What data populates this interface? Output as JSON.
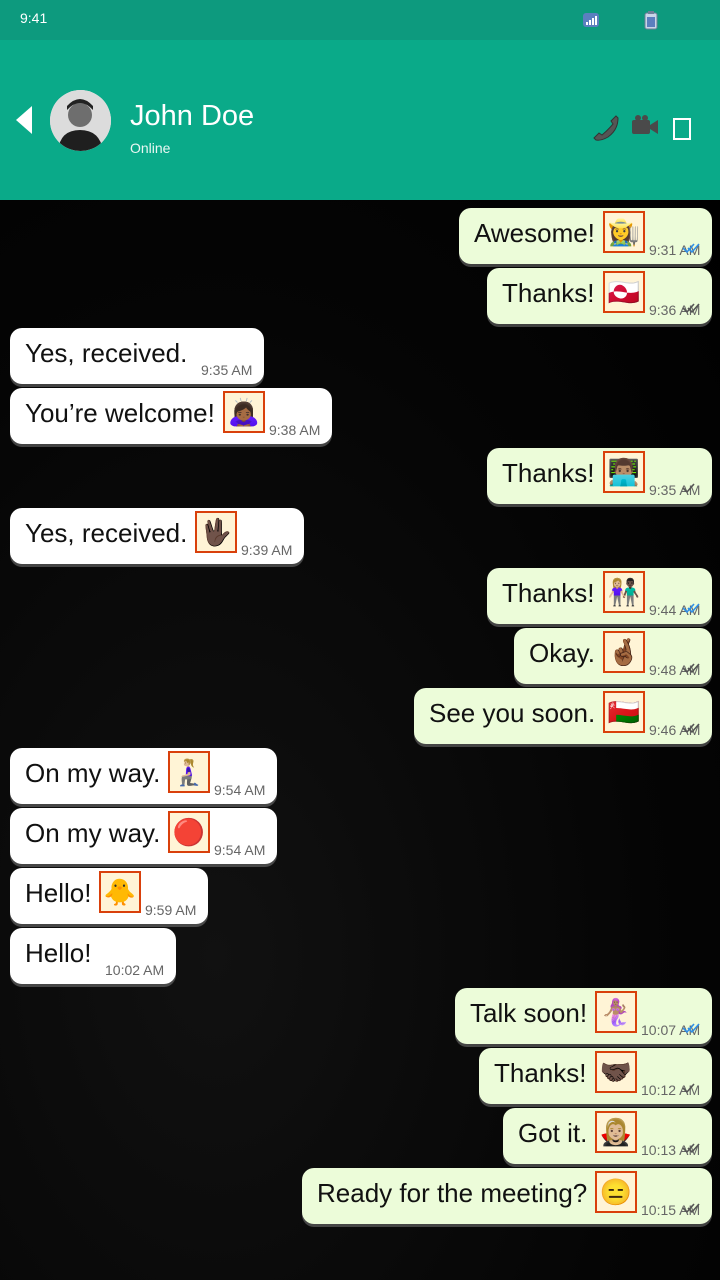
{
  "status_bar": {
    "time": "9:41"
  },
  "header": {
    "contact_name": "John Doe",
    "contact_status": "Online"
  },
  "colors": {
    "app_bar": "#0aaa89",
    "status_bar": "#0d9a7e",
    "outgoing_bubble": "#ecfcd9",
    "incoming_bubble": "#ffffff",
    "read_tick": "#2f8fe6",
    "sent_tick": "#555555"
  },
  "messages": [
    {
      "direction": "out",
      "text": "Awesome!",
      "emoji": "👩‍🌾",
      "time": "9:31 AM",
      "status": "read"
    },
    {
      "direction": "out",
      "text": "Thanks!",
      "emoji": "🇬🇱",
      "time": "9:36 AM",
      "status": "delivered"
    },
    {
      "direction": "in",
      "text": "Yes, received.",
      "emoji": "",
      "time": "9:35 AM"
    },
    {
      "direction": "in",
      "text": "You’re welcome!",
      "emoji": "🙇🏾‍♀️",
      "time": "9:38 AM"
    },
    {
      "direction": "out",
      "text": "Thanks!",
      "emoji": "👨🏽‍💻",
      "time": "9:35 AM",
      "status": "sent"
    },
    {
      "direction": "in",
      "text": "Yes, received.",
      "emoji": "🖖🏿",
      "time": "9:39 AM"
    },
    {
      "direction": "out",
      "text": "Thanks!",
      "emoji": "👩🏼‍🤝‍👨🏿",
      "time": "9:44 AM",
      "status": "read"
    },
    {
      "direction": "out",
      "text": "Okay.",
      "emoji": "🤞🏾",
      "time": "9:48 AM",
      "status": "delivered"
    },
    {
      "direction": "out",
      "text": "See you soon.",
      "emoji": "🇴🇲",
      "time": "9:46 AM",
      "status": "delivered"
    },
    {
      "direction": "in",
      "text": "On my way.",
      "emoji": "🧎🏼‍♀️",
      "time": "9:54 AM"
    },
    {
      "direction": "in",
      "text": "On my way.",
      "emoji": "🔴",
      "time": "9:54 AM"
    },
    {
      "direction": "in",
      "text": "Hello!",
      "emoji": "🐥",
      "time": "9:59 AM"
    },
    {
      "direction": "in",
      "text": "Hello!",
      "emoji": "",
      "time": "10:02 AM"
    },
    {
      "direction": "out",
      "text": "Talk soon!",
      "emoji": "🧜🏽‍♀️",
      "time": "10:07 AM",
      "status": "read"
    },
    {
      "direction": "out",
      "text": "Thanks!",
      "emoji": "🤝🏿",
      "time": "10:12 AM",
      "status": "sent"
    },
    {
      "direction": "out",
      "text": "Got it.",
      "emoji": "🧛🏼‍♀️",
      "time": "10:13 AM",
      "status": "delivered"
    },
    {
      "direction": "out",
      "text": "Ready for the meeting?",
      "emoji": "😑",
      "time": "10:15 AM",
      "status": "delivered"
    }
  ]
}
